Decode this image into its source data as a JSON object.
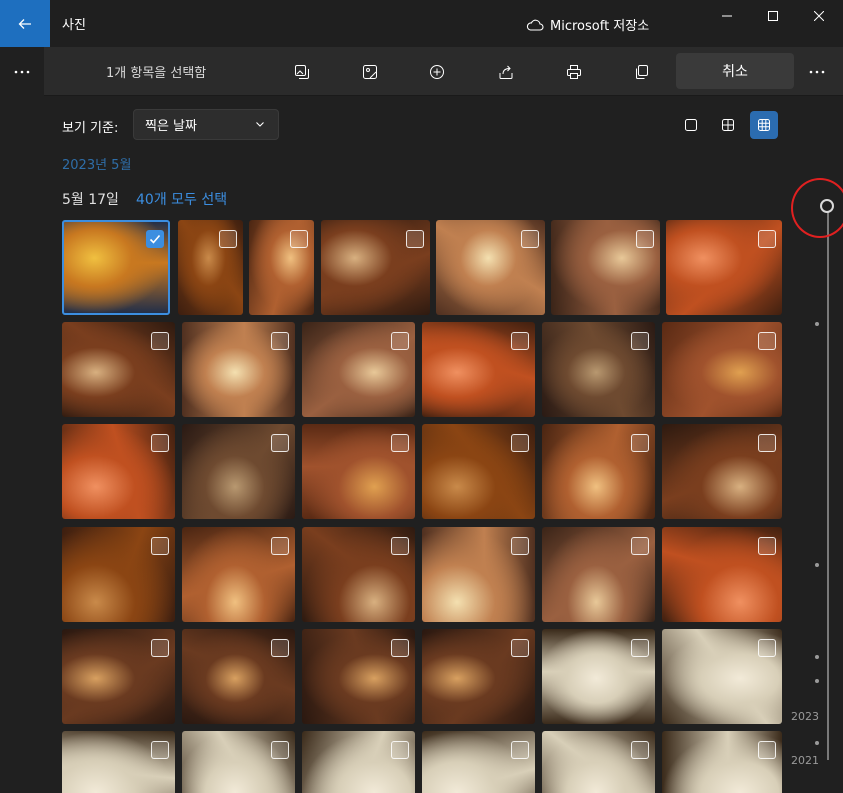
{
  "titlebar": {
    "app_title": "사진",
    "cloud_label": "Microsoft 저장소"
  },
  "toolbar": {
    "selection_text": "1개 항목을 선택함",
    "cancel_label": "취소"
  },
  "filter": {
    "view_by_label": "보기 기준:",
    "sort_value": "찍은 날짜"
  },
  "gallery": {
    "month_title": "2023년 5월",
    "day_title": "5월 17일",
    "select_all_label": "40개 모두 선택",
    "selected_index": 0
  },
  "timeline": {
    "years": [
      "2023",
      "2021"
    ]
  },
  "colors": {
    "accent": "#3c8ee0",
    "back_button": "#1e6fbf"
  }
}
